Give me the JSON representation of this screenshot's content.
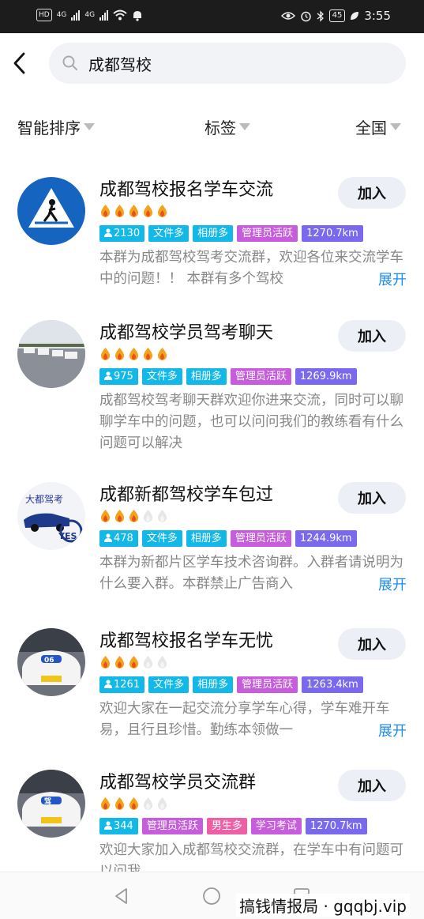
{
  "status_bar": {
    "hd": "HD",
    "net1": "4G",
    "net2": "4G",
    "battery": "45",
    "time": "3:55"
  },
  "search": {
    "query": "成都驾校"
  },
  "filters": [
    {
      "label": "智能排序"
    },
    {
      "label": "标签"
    },
    {
      "label": "全国"
    }
  ],
  "join_label": "加入",
  "expand_label": "展开",
  "groups": [
    {
      "name": "成都驾校报名学车交流",
      "flames": 5,
      "members": "2130",
      "tags": [
        "文件多",
        "相册多",
        "管理员活跃"
      ],
      "distance": "1270.7km",
      "desc": "本群为成都驾校驾考交流群，欢迎各位来交流学车中的问题！！ 本群有多个驾校",
      "expandable": true
    },
    {
      "name": "成都驾校学员驾考聊天",
      "flames": 5,
      "members": "975",
      "tags": [
        "文件多",
        "相册多",
        "管理员活跃"
      ],
      "distance": "1269.9km",
      "desc": "成都驾校驾考聊天群欢迎你进来交流，同时可以聊聊学车中的问题，也可以问问我们的教练看有什么问题可以解决",
      "expandable": false
    },
    {
      "name": "成都新都驾校学车包过",
      "flames": 3,
      "members": "478",
      "tags": [
        "文件多",
        "相册多",
        "管理员活跃"
      ],
      "distance": "1244.9km",
      "desc": "本群为新都片区学车技术咨询群。入群者请说明为什么要入群。本群禁止广告商入",
      "expandable": true
    },
    {
      "name": "成都驾校报名学车无忧",
      "flames": 3,
      "members": "1261",
      "tags": [
        "文件多",
        "相册多",
        "管理员活跃"
      ],
      "distance": "1263.4km",
      "desc": "欢迎大家在一起交流分享学车心得，学车难开车易，且行且珍惜。勤练本领做一",
      "expandable": true
    },
    {
      "name": "成都驾校学员交流群",
      "flames": 3,
      "members": "344",
      "tags": [
        "管理员活跃",
        "男生多",
        "学习考试"
      ],
      "distance": "1270.7km",
      "desc": "欢迎大家加入成都驾校交流群，在学车中有问题可以问我，",
      "expandable": false
    }
  ],
  "watermark": "搞钱情报局 · gqqbj.vip",
  "colors": {
    "accent": "#1a8cf0",
    "tag_cyan": "#12b8e8",
    "tag_magenta": "#c75cdd",
    "tag_purple": "#7a68ee",
    "tag_pink": "#ef5fa6",
    "flame": "#f4a21c"
  }
}
